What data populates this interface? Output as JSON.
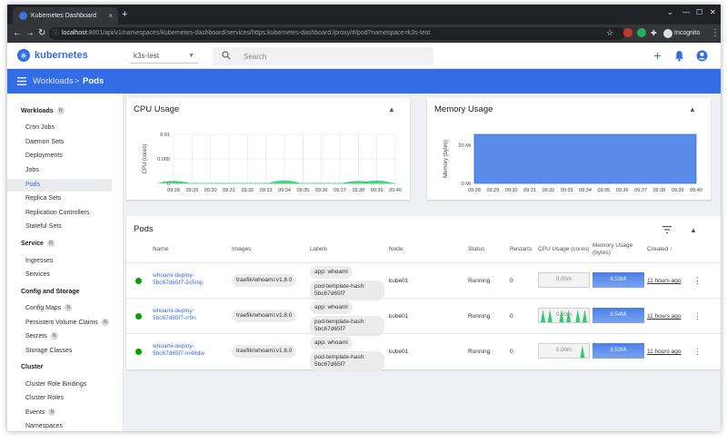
{
  "browser": {
    "tab_title": "Kubernetes Dashboard",
    "tab_close": "×",
    "new_tab": "+",
    "controls": [
      "⌄",
      "—",
      "☐",
      "✕"
    ],
    "url_host": "localhost",
    "url_path": ":8001/api/v1/namespaces/kubernetes-dashboard/services/https:kubernetes-dashboard:/proxy/#/pod?namespace=k3s-test",
    "incognito_label": "Incognito",
    "star": "☆"
  },
  "header": {
    "brand": "kubernetes",
    "namespace": "k3s-test",
    "search_placeholder": "Search",
    "add_icon": "+",
    "bell_icon": "🔔",
    "account_icon": "●"
  },
  "breadcrumb": {
    "parent": "Workloads",
    "separator": ">",
    "current": "Pods"
  },
  "sidebar": {
    "workloads_label": "Workloads",
    "workloads_badge": "N",
    "workloads": [
      "Cron Jobs",
      "Daemon Sets",
      "Deployments",
      "Jobs",
      "Pods",
      "Replica Sets",
      "Replication Controllers",
      "Stateful Sets"
    ],
    "service_label": "Service",
    "service_badge": "N",
    "service": [
      "Ingresses",
      "Services"
    ],
    "config_label": "Config and Storage",
    "config": [
      "Config Maps",
      "Persistent Volume Claims",
      "Secrets",
      "Storage Classes"
    ],
    "config_badges": [
      "N",
      "N",
      "N",
      ""
    ],
    "cluster_label": "Cluster",
    "cluster": [
      "Cluster Role Bindings",
      "Cluster Roles",
      "Events",
      "Namespaces"
    ],
    "cluster_badges": [
      "",
      "",
      "N",
      ""
    ]
  },
  "cpu_card": {
    "title": "CPU Usage",
    "collapse_icon": "▲"
  },
  "memory_card": {
    "title": "Memory Usage",
    "collapse_icon": "▲"
  },
  "chart_data": [
    {
      "type": "area",
      "title": "CPU Usage",
      "ylabel": "CPU (cores)",
      "xlabel": "",
      "ylim": [
        0,
        0.01
      ],
      "yticks": [
        0,
        0.005,
        0.01
      ],
      "ytick_labels": [
        "0",
        "0.005",
        "0.01"
      ],
      "x": [
        "09:28",
        "09:29",
        "09:30",
        "09:31",
        "09:32",
        "09:33",
        "09:34",
        "09:35",
        "09:36",
        "09:37",
        "09:38",
        "09:39",
        "09:40"
      ],
      "values": [
        0.0005,
        0,
        0,
        0,
        0,
        0,
        0.0006,
        0,
        0,
        0,
        0.0005,
        0.0006,
        0
      ],
      "color": "#2ecc71",
      "grid": true
    },
    {
      "type": "area",
      "title": "Memory Usage",
      "ylabel": "Memory (bytes)",
      "xlabel": "",
      "ylim": [
        0,
        25.6
      ],
      "yticks": [
        0,
        20
      ],
      "ytick_labels": [
        "0 Mi",
        "20 Mi"
      ],
      "x": [
        "09:28",
        "09:29",
        "09:30",
        "09:31",
        "09:32",
        "09:33",
        "09:34",
        "09:35",
        "09:36",
        "09:37",
        "09:38",
        "09:39",
        "09:40"
      ],
      "values": [
        25.6,
        25.6,
        25.6,
        25.6,
        25.6,
        25.6,
        25.6,
        25.6,
        25.6,
        25.6,
        25.6,
        25.6,
        25.6
      ],
      "color": "#326de6",
      "grid": true
    }
  ],
  "pods": {
    "title": "Pods",
    "collapse_icon": "▲",
    "columns": [
      "Name",
      "Images",
      "Labels",
      "Node",
      "Status",
      "Restarts",
      "CPU Usage (cores)",
      "Memory Usage (bytes)",
      "Created ↑"
    ],
    "rows": [
      {
        "name": "whoami-deploy-5bc67d65f7-2x5mp",
        "image": "traefik/whoami:v1.8.0",
        "label1": "app: whoami",
        "label2": "pod-template-hash: 5bc67d65f7",
        "node": "kube01",
        "status": "Running",
        "restarts": "0",
        "cpu": "0.00m",
        "memory": "8.53Mi",
        "created": "11 hours ago",
        "cpu_spikes": []
      },
      {
        "name": "whoami-deploy-5bc67d65f7-rr9n",
        "image": "traefik/whoami:v1.8.0",
        "label1": "app: whoami",
        "label2": "pod-template-hash: 5bc67d65f7",
        "node": "kube01",
        "status": "Running",
        "restarts": "0",
        "cpu": "0.00m",
        "memory": "8.54Mi",
        "created": "11 hours ago",
        "cpu_spikes": [
          0.05,
          0.2,
          0.45,
          0.6,
          0.8,
          0.95
        ]
      },
      {
        "name": "whoami-deploy-5bc67d65f7-m48dw",
        "image": "traefik/whoami:v1.8.0",
        "label1": "app: whoami",
        "label2": "pod-template-hash: 5bc67d65f7",
        "node": "kube01",
        "status": "Running",
        "restarts": "0",
        "cpu": "0.00m",
        "memory": "8.53Mi",
        "created": "11 hours ago",
        "cpu_spikes": [
          0.9
        ]
      }
    ],
    "kebab": "⋮"
  }
}
